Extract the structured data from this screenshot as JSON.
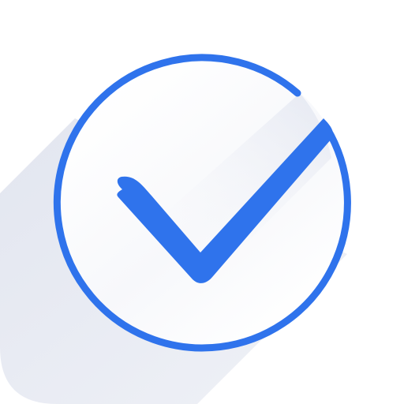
{
  "icon": {
    "name": "checkmark-circle-icon",
    "accent_color": "#2f73ec",
    "background_color": "#ffffff",
    "shadow_color": "#d7dbe8"
  }
}
